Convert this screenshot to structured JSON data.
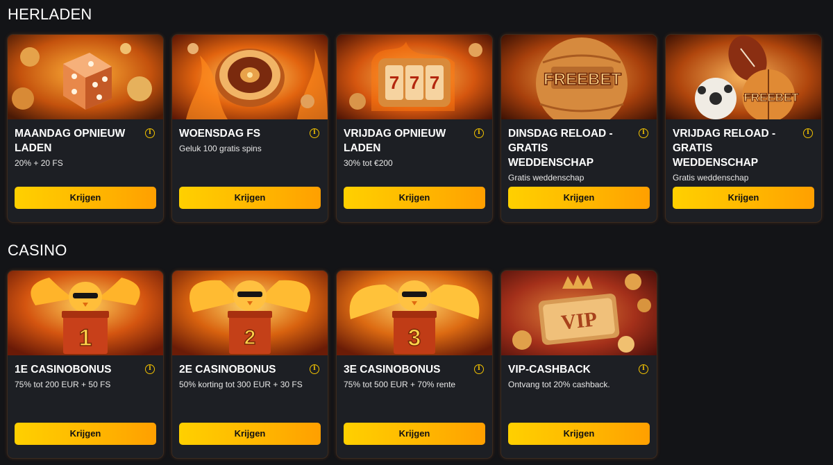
{
  "sections": [
    {
      "title": "HERLADEN",
      "cards": [
        {
          "title": "MAANDAG OPNIEUW LADEN",
          "subtitle": "20% + 20 FS",
          "button": "Krijgen",
          "image": "dice-coins"
        },
        {
          "title": "WOENSDAG FS",
          "subtitle": "Geluk 100 gratis spins",
          "button": "Krijgen",
          "image": "roulette-fire"
        },
        {
          "title": "VRIJDAG OPNIEUW LADEN",
          "subtitle": "30% tot €200",
          "button": "Krijgen",
          "image": "slot-777"
        },
        {
          "title": "DINSDAG RELOAD - GRATIS WEDDENSCHAP",
          "subtitle": "Gratis weddenschap",
          "button": "Krijgen",
          "image": "freebet-ball",
          "image_text": "FREEBET"
        },
        {
          "title": "VRIJDAG RELOAD - GRATIS WEDDENSCHAP",
          "subtitle": "Gratis weddenschap",
          "button": "Krijgen",
          "image": "freebet-balls",
          "image_text": "FREEBET"
        }
      ]
    },
    {
      "title": "CASINO",
      "cards": [
        {
          "title": "1E CASINOBONUS",
          "subtitle": "75% tot 200 EUR + 50 FS",
          "button": "Krijgen",
          "image": "chick-gift",
          "image_text": "1"
        },
        {
          "title": "2E CASINOBONUS",
          "subtitle": "50% korting tot 300 EUR + 30 FS",
          "button": "Krijgen",
          "image": "chick-gift",
          "image_text": "2"
        },
        {
          "title": "3E CASINOBONUS",
          "subtitle": "75% tot 500 EUR + 70% rente",
          "button": "Krijgen",
          "image": "chick-gift",
          "image_text": "3"
        },
        {
          "title": "VIP-CASHBACK",
          "subtitle": "Ontvang tot 20% cashback.",
          "button": "Krijgen",
          "image": "vip-crown",
          "image_text": "VIP"
        }
      ]
    }
  ],
  "icons": {
    "info": "info-icon"
  },
  "colors": {
    "accent": "#ffc400",
    "background": "#131417",
    "card": "#1d1f24"
  }
}
